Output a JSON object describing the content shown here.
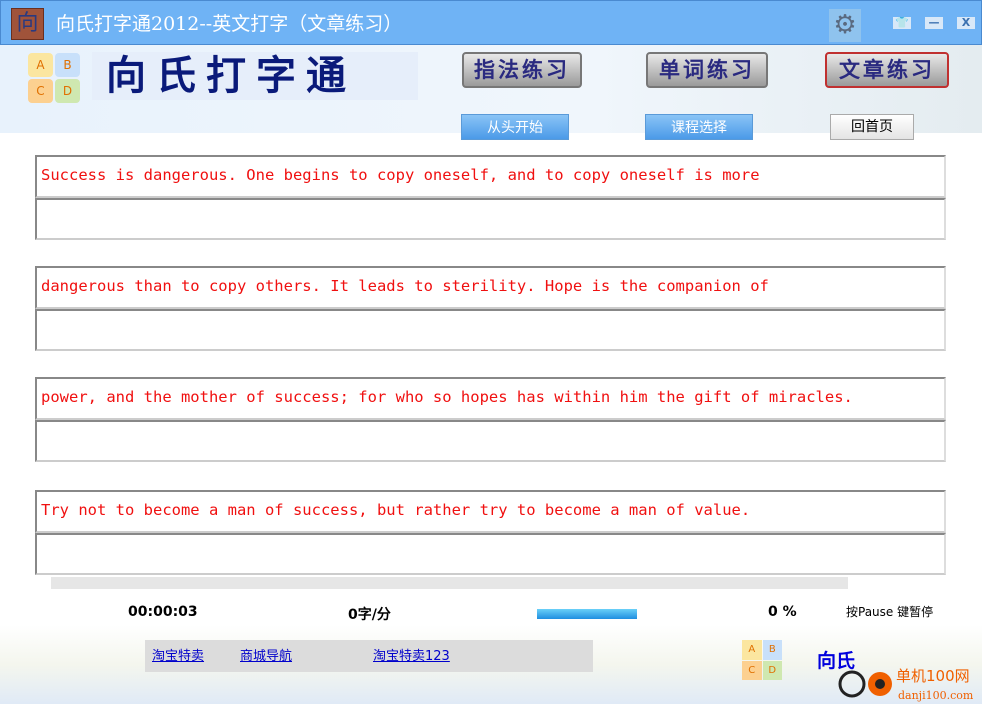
{
  "window": {
    "title": "向氏打字通2012--英文打字（文章练习）",
    "icon_char": "向",
    "buttons": {
      "skin": "皮肤",
      "minimize": "—",
      "close": "X"
    }
  },
  "header": {
    "logo_letters": [
      "A",
      "B",
      "C",
      "D"
    ],
    "brand": "向氏打字通",
    "modes": [
      {
        "label": "指法练习"
      },
      {
        "label": "单词练习"
      },
      {
        "label": "文章练习",
        "active": true
      }
    ],
    "actions": {
      "restart": "从头开始",
      "course": "课程选择",
      "home": "回首页"
    }
  },
  "lines": [
    {
      "text": "Success is dangerous. One begins to copy oneself, and to copy oneself is more",
      "typed": ""
    },
    {
      "text": "dangerous than to copy others. It leads to sterility. Hope is the companion of",
      "typed": ""
    },
    {
      "text": "power, and the mother of success; for who so hopes has within him the gift of miracles.",
      "typed": ""
    },
    {
      "text": "Try not to become a man of success, but rather try to become a man of value.",
      "typed": ""
    }
  ],
  "status": {
    "elapsed": "00:00:03",
    "speed": "0字/分",
    "progress_percent": 0,
    "progress_text": "0 %",
    "pause_hint": "按Pause 键暂停"
  },
  "footer": {
    "links": [
      "淘宝特卖",
      "商城导航",
      "淘宝特卖123"
    ],
    "brand": "向氏",
    "watermark": "单机100网 danji100.com"
  },
  "colors": {
    "titlebar": "#6fb3f5",
    "target_text": "#f01010",
    "brand": "#0a1a7a",
    "link": "#0000cc"
  }
}
